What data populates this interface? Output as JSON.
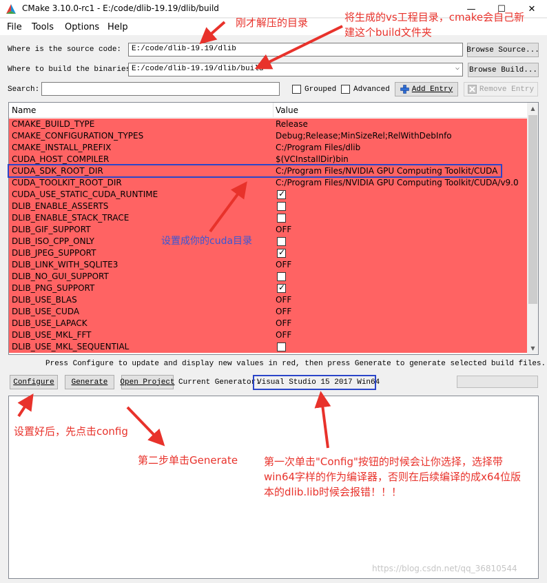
{
  "window": {
    "title": "CMake 3.10.0-rc1 - E:/code/dlib-19.19/dlib/build",
    "minimize": "—",
    "maximize": "☐",
    "close": "✕"
  },
  "menu": [
    "File",
    "Tools",
    "Options",
    "Help"
  ],
  "source": {
    "label": "Where is the source code:",
    "value": "E:/code/dlib-19.19/dlib",
    "browse": "Browse Source..."
  },
  "build": {
    "label": "Where to build the binaries:",
    "value": "E:/code/dlib-19.19/dlib/build",
    "browse": "Browse Build..."
  },
  "search": {
    "label": "Search:",
    "value": "",
    "grouped": "Grouped",
    "advanced": "Advanced",
    "add_entry": "Add Entry",
    "remove_entry": "Remove Entry"
  },
  "table": {
    "col_name": "Name",
    "col_value": "Value",
    "rows": [
      {
        "name": "CMAKE_BUILD_TYPE",
        "value": "Release"
      },
      {
        "name": "CMAKE_CONFIGURATION_TYPES",
        "value": "Debug;Release;MinSizeRel;RelWithDebInfo"
      },
      {
        "name": "CMAKE_INSTALL_PREFIX",
        "value": "C:/Program Files/dlib"
      },
      {
        "name": "CUDA_HOST_COMPILER",
        "value": "$(VCInstallDir)bin"
      },
      {
        "name": "CUDA_SDK_ROOT_DIR",
        "value": "C:/Program Files/NVIDIA GPU Computing Toolkit/CUDA"
      },
      {
        "name": "CUDA_TOOLKIT_ROOT_DIR",
        "value": "C:/Program Files/NVIDIA GPU Computing Toolkit/CUDA/v9.0"
      },
      {
        "name": "CUDA_USE_STATIC_CUDA_RUNTIME",
        "checkbox": true,
        "checked": true
      },
      {
        "name": "DLIB_ENABLE_ASSERTS",
        "checkbox": true,
        "checked": false
      },
      {
        "name": "DLIB_ENABLE_STACK_TRACE",
        "checkbox": true,
        "checked": false
      },
      {
        "name": "DLIB_GIF_SUPPORT",
        "value": "OFF"
      },
      {
        "name": "DLIB_ISO_CPP_ONLY",
        "checkbox": true,
        "checked": false
      },
      {
        "name": "DLIB_JPEG_SUPPORT",
        "checkbox": true,
        "checked": true
      },
      {
        "name": "DLIB_LINK_WITH_SQLITE3",
        "value": "OFF"
      },
      {
        "name": "DLIB_NO_GUI_SUPPORT",
        "checkbox": true,
        "checked": false
      },
      {
        "name": "DLIB_PNG_SUPPORT",
        "checkbox": true,
        "checked": true
      },
      {
        "name": "DLIB_USE_BLAS",
        "value": "OFF"
      },
      {
        "name": "DLIB_USE_CUDA",
        "value": "OFF"
      },
      {
        "name": "DLIB_USE_LAPACK",
        "value": "OFF"
      },
      {
        "name": "DLIB_USE_MKL_FFT",
        "value": "OFF"
      },
      {
        "name": "DLIB_USE_MKL_SEQUENTIAL",
        "checkbox": true,
        "checked": false
      }
    ]
  },
  "status_message": "Press Configure to update and display new values in red, then press Generate to generate selected build files.",
  "actions": {
    "configure": "Configure",
    "generate": "Generate",
    "open_project": "Open Project",
    "generator_label": "Current Generator:",
    "generator_value": "Visual Studio 15 2017 Win64"
  },
  "annotations": {
    "source_note": "刚才解压的目录",
    "build_note_line1": "将生成的vs工程目录，cmake会自己新",
    "build_note_line2": "建这个build文件夹",
    "cuda_note": "设置成你的cuda目录",
    "configure_note": "设置好后，先点击config",
    "generate_note": "第二步单击Generate",
    "generator_note_line1": "第一次单击\"Config\"按钮的时候会让你选择，选择带",
    "generator_note_line2": "win64字样的作为编译器，否则在后续编译的成x64位版",
    "generator_note_line3": "本的dlib.lib时候会报错！！！"
  },
  "watermark": "https://blog.csdn.net/qq_36810544",
  "colors": {
    "changed_row": "#ff6363",
    "annotation_red": "#e8322b",
    "highlight_blue": "#2a45c9"
  }
}
